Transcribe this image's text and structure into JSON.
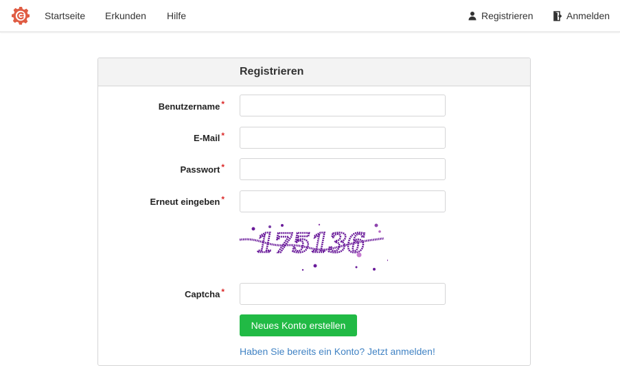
{
  "nav": {
    "logo_icon": "gitea-gear-logo-icon",
    "links": [
      "Startseite",
      "Erkunden",
      "Hilfe"
    ],
    "register_label": "Registrieren",
    "register_icon": "person-icon",
    "login_label": "Anmelden",
    "login_icon": "sign-in-door-icon"
  },
  "form": {
    "title": "Registrieren",
    "fields": [
      {
        "label": "Benutzername",
        "value": ""
      },
      {
        "label": "E-Mail",
        "value": ""
      },
      {
        "label": "Passwort",
        "value": ""
      },
      {
        "label": "Erneut eingeben",
        "value": ""
      }
    ],
    "required_mark": "*",
    "captcha_text": "175136",
    "captcha_label": "Captcha",
    "submit_label": "Neues Konto erstellen",
    "login_link": "Haben Sie bereits ein Konto? Jetzt anmelden!"
  },
  "colors": {
    "accent_green": "#21ba45",
    "link_blue": "#4183c4",
    "required_red": "#db2828",
    "logo_red": "#e05d44",
    "captcha_purple": "#6a1b9a"
  }
}
